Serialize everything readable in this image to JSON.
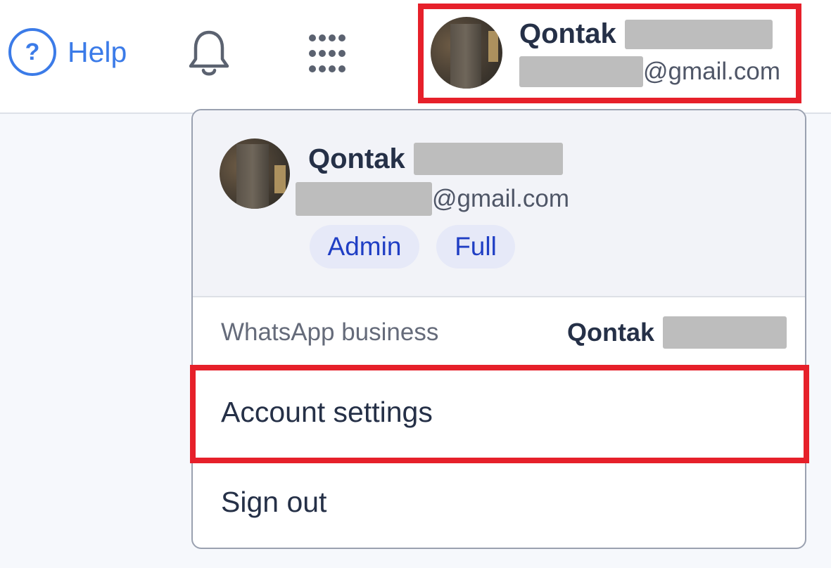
{
  "topbar": {
    "help": {
      "icon": "question-circle-icon",
      "glyph": "?",
      "label": "Help"
    },
    "notifications_icon": "bell-icon",
    "apps_icon": "grid-dots-icon",
    "profile": {
      "name": "Qontak",
      "email_suffix": "@gmail.com"
    }
  },
  "dropdown": {
    "name": "Qontak",
    "email_suffix": "@gmail.com",
    "badges": [
      "Admin",
      "Full"
    ],
    "whatsapp": {
      "label": "WhatsApp business",
      "account": "Qontak"
    },
    "menu": {
      "account_settings": "Account settings",
      "sign_out": "Sign out"
    }
  },
  "colors": {
    "accent": "#3b7be8",
    "highlight_frame": "#e6202a",
    "badge_bg": "#e6e9f8",
    "badge_text": "#1f3ec4"
  }
}
